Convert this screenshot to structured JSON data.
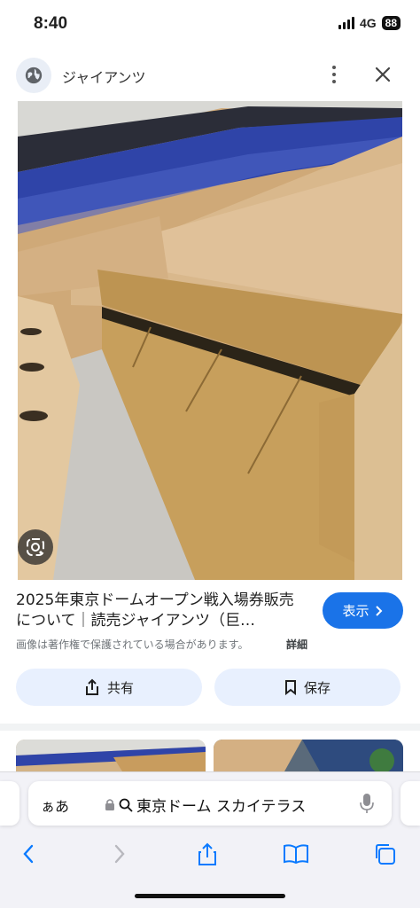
{
  "status_bar": {
    "time": "8:40",
    "network": "4G",
    "battery": "88"
  },
  "header": {
    "site_name": "ジャイアンツ",
    "globe_icon": "globe-icon",
    "more_icon": "more-vert-icon",
    "close_icon": "close-icon"
  },
  "image": {
    "lens_icon": "google-lens-icon"
  },
  "info": {
    "title": "2025年東京ドームオープン戦入場券販売について｜読売ジャイアンツ（巨…",
    "visit_label": "表示",
    "copyright_note": "画像は著作権で保護されている場合があります。",
    "details_label": "詳細"
  },
  "actions": {
    "share_label": "共有",
    "save_label": "保存"
  },
  "safari": {
    "aa_label": "ぁあ",
    "url_text": "東京ドーム スカイテラス",
    "lock_icon": "lock-icon",
    "search_icon": "search-icon",
    "mic_icon": "microphone-icon"
  },
  "colors": {
    "accent": "#1a73e8",
    "action_bg": "#e8f0fe",
    "toolbar_bg": "#f2f2f7",
    "ios_blue": "#0a7aff"
  }
}
